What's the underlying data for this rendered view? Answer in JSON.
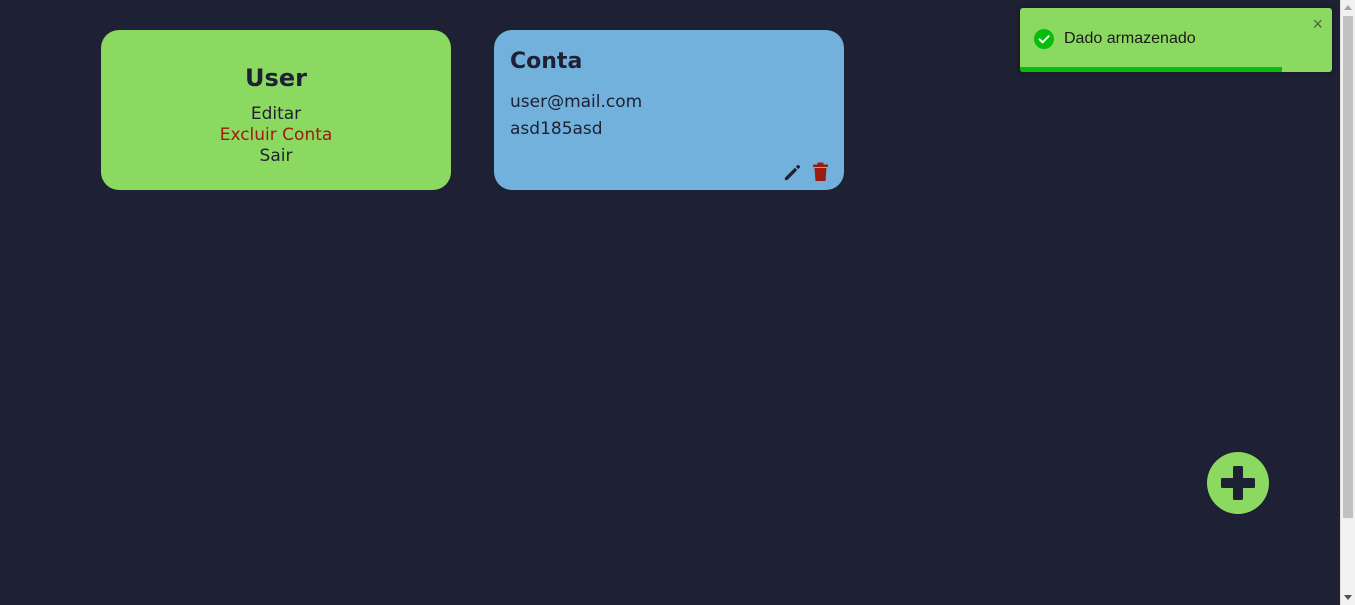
{
  "user_card": {
    "title": "User",
    "menu": [
      {
        "label": "Editar"
      },
      {
        "label": "Excluir Conta"
      },
      {
        "label": "Sair"
      }
    ]
  },
  "account_card": {
    "title": "Conta",
    "email": "user@mail.com",
    "password": "asd185asd",
    "actions": {
      "edit_icon": "pencil-icon",
      "delete_icon": "trash-icon"
    }
  },
  "toast": {
    "message": "Dado armazenado",
    "icon": "check-circle-icon",
    "close": "×",
    "progress_fraction": 0.84
  },
  "fab": {
    "icon": "plus-icon"
  },
  "colors": {
    "background": "#1e2033",
    "green": "#8cd962",
    "blue": "#72b1db",
    "danger": "#9b1b10",
    "success": "#07bc0c"
  }
}
